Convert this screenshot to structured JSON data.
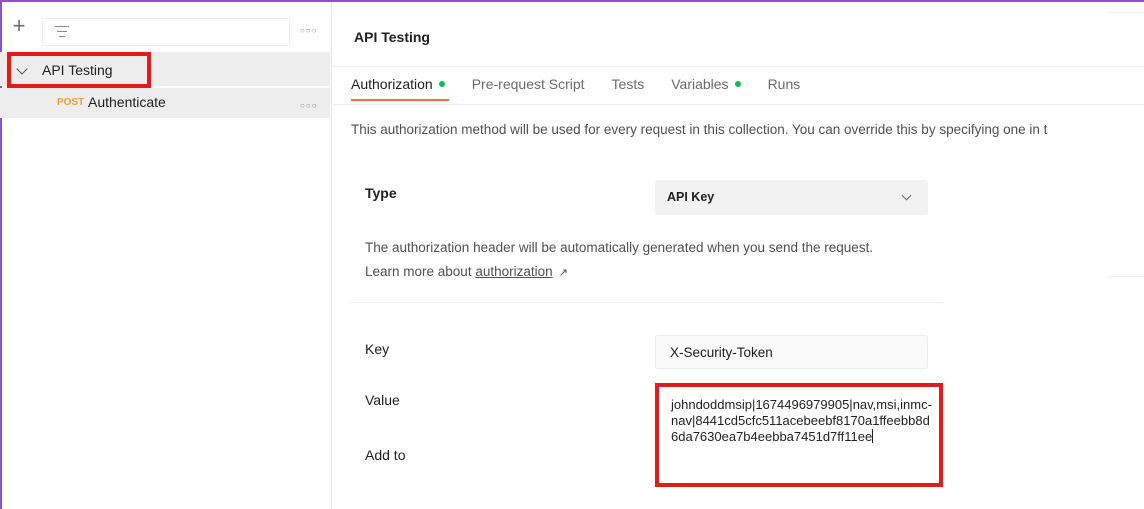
{
  "sidebar": {
    "collection": {
      "label": "API Testing"
    },
    "requests": [
      {
        "method": "POST",
        "label": "Authenticate"
      }
    ]
  },
  "main": {
    "title": "API Testing",
    "tabs": [
      {
        "label": "Authorization",
        "has_dot": true,
        "active": true
      },
      {
        "label": "Pre-request Script",
        "has_dot": false,
        "active": false
      },
      {
        "label": "Tests",
        "has_dot": false,
        "active": false
      },
      {
        "label": "Variables",
        "has_dot": true,
        "active": false
      },
      {
        "label": "Runs",
        "has_dot": false,
        "active": false
      }
    ],
    "description": "This authorization method will be used for every request in this collection. You can override this by specifying one in t",
    "type_label": "Type",
    "type_value": "API Key",
    "help_text": "The authorization header will be automatically generated when you send the request. Learn more about ",
    "help_link": "authorization",
    "key_label": "Key",
    "key_value": "X-Security-Token",
    "value_label": "Value",
    "value_value": "johndoddmsip|1674496979905|nav,msi,inmc-nav|8441cd5cfc511acebeebf8170a1ffeebb8d6da7630ea7b4eebba7451d7ff11ee",
    "addto_label": "Add to"
  },
  "colors": {
    "accent": "#ff6c37",
    "highlight": "#e21b1b",
    "status_dot": "#0cbb52",
    "method_post": "#e8a13a"
  },
  "icons": [
    "plus-icon",
    "filter-icon",
    "more-icon",
    "chevron-down-icon",
    "external-link-icon"
  ]
}
